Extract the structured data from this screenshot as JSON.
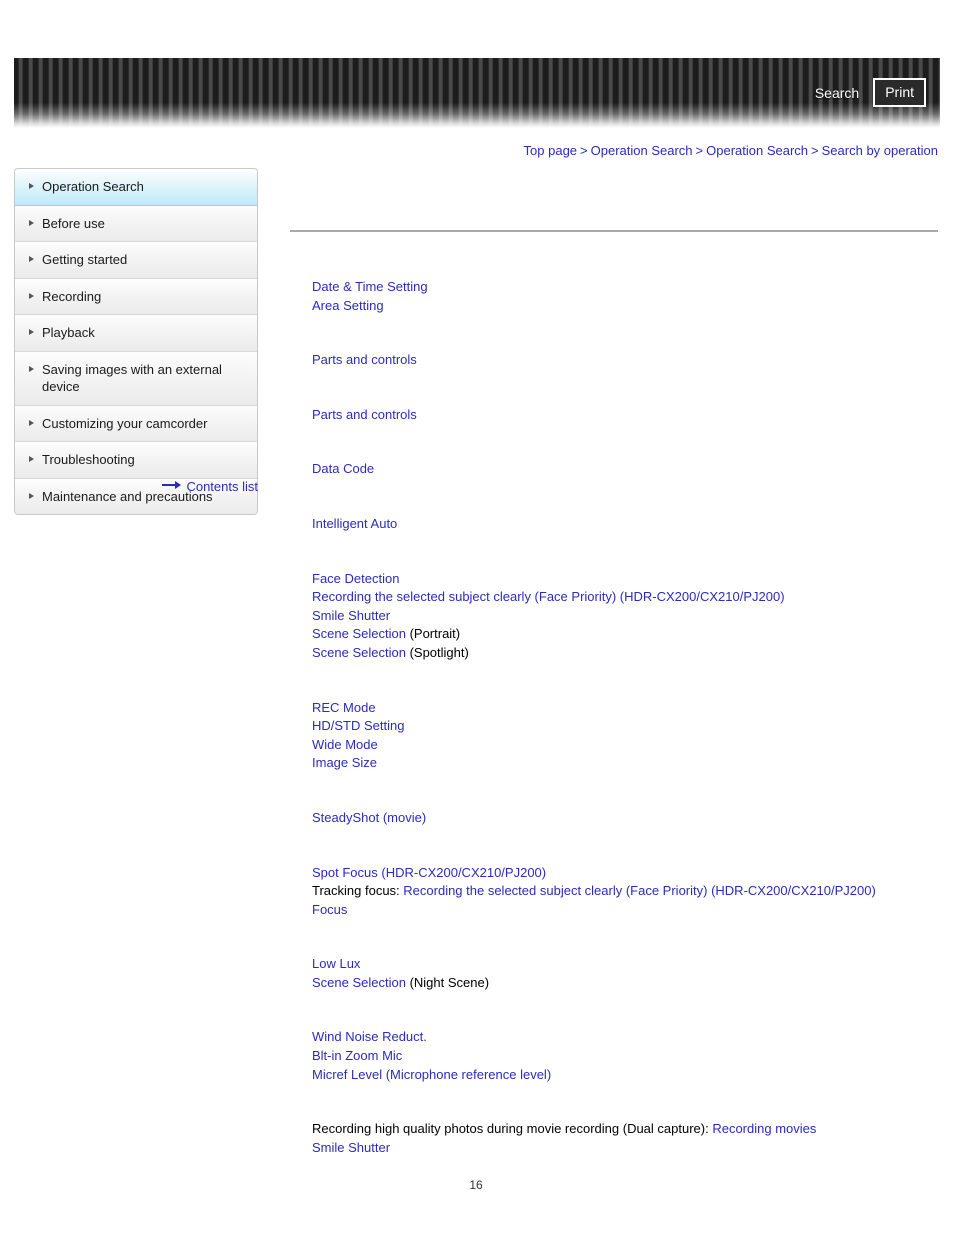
{
  "header": {
    "search_label": "Search",
    "print_label": "Print"
  },
  "breadcrumb": {
    "separator": ">",
    "items": [
      {
        "label": "Top page"
      },
      {
        "label": "Operation Search"
      },
      {
        "label": "Operation Search"
      },
      {
        "label": "Search by operation"
      }
    ]
  },
  "sidebar": {
    "items": [
      {
        "label": "Operation Search",
        "selected": true
      },
      {
        "label": "Before use",
        "selected": false
      },
      {
        "label": "Getting started",
        "selected": false
      },
      {
        "label": "Recording",
        "selected": false
      },
      {
        "label": "Playback",
        "selected": false
      },
      {
        "label": "Saving images with an external device",
        "selected": false
      },
      {
        "label": "Customizing your camcorder",
        "selected": false
      },
      {
        "label": "Troubleshooting",
        "selected": false
      },
      {
        "label": "Maintenance and precautions",
        "selected": false
      }
    ],
    "contents_list_label": "Contents list",
    "contents_arrow_icon": "right-arrow-icon"
  },
  "content": {
    "sections": [
      {
        "lines": [
          [
            {
              "t": "Date & Time Setting",
              "link": true
            }
          ],
          [
            {
              "t": "Area Setting",
              "link": true
            }
          ]
        ]
      },
      {
        "lines": [
          [
            {
              "t": "Parts and controls",
              "link": true
            }
          ]
        ]
      },
      {
        "lines": [
          [
            {
              "t": "Parts and controls",
              "link": true
            }
          ]
        ]
      },
      {
        "lines": [
          [
            {
              "t": "Data Code",
              "link": true
            }
          ]
        ]
      },
      {
        "lines": [
          [
            {
              "t": "Intelligent Auto",
              "link": true
            }
          ]
        ]
      },
      {
        "lines": [
          [
            {
              "t": "Face Detection",
              "link": true
            }
          ],
          [
            {
              "t": "Recording the selected subject clearly (Face Priority) (HDR-CX200/CX210/PJ200)",
              "link": true
            }
          ],
          [
            {
              "t": "Smile Shutter",
              "link": true
            }
          ],
          [
            {
              "t": "Scene Selection",
              "link": true
            },
            {
              "t": " (Portrait)",
              "link": false
            }
          ],
          [
            {
              "t": "Scene Selection",
              "link": true
            },
            {
              "t": " (Spotlight)",
              "link": false
            }
          ]
        ]
      },
      {
        "lines": [
          [
            {
              "t": "REC Mode",
              "link": true
            }
          ],
          [
            {
              "t": "HD/STD Setting",
              "link": true
            }
          ],
          [
            {
              "t": "Wide Mode",
              "link": true
            }
          ],
          [
            {
              "t": "Image Size",
              "link": true
            }
          ]
        ]
      },
      {
        "lines": [
          [
            {
              "t": "SteadyShot (movie)",
              "link": true
            }
          ]
        ]
      },
      {
        "lines": [
          [
            {
              "t": "Spot Focus (HDR-CX200/CX210/PJ200)",
              "link": true
            }
          ],
          [
            {
              "t": "Tracking focus: ",
              "link": false
            },
            {
              "t": "Recording the selected subject clearly (Face Priority) (HDR-CX200/CX210/PJ200)",
              "link": true
            }
          ],
          [
            {
              "t": "Focus",
              "link": true
            }
          ]
        ]
      },
      {
        "lines": [
          [
            {
              "t": "Low Lux",
              "link": true
            }
          ],
          [
            {
              "t": "Scene Selection",
              "link": true
            },
            {
              "t": " (Night Scene)",
              "link": false
            }
          ]
        ]
      },
      {
        "lines": [
          [
            {
              "t": "Wind Noise Reduct.",
              "link": true
            }
          ],
          [
            {
              "t": "Blt-in Zoom Mic",
              "link": true
            }
          ],
          [
            {
              "t": "Micref Level (Microphone reference level)",
              "link": true
            }
          ]
        ]
      },
      {
        "lines": [
          [
            {
              "t": "Recording high quality photos during movie recording (Dual capture): ",
              "link": false
            },
            {
              "t": "Recording movies",
              "link": true
            }
          ],
          [
            {
              "t": "Smile Shutter",
              "link": true
            }
          ]
        ]
      }
    ]
  },
  "footer": {
    "page_number": "16"
  }
}
